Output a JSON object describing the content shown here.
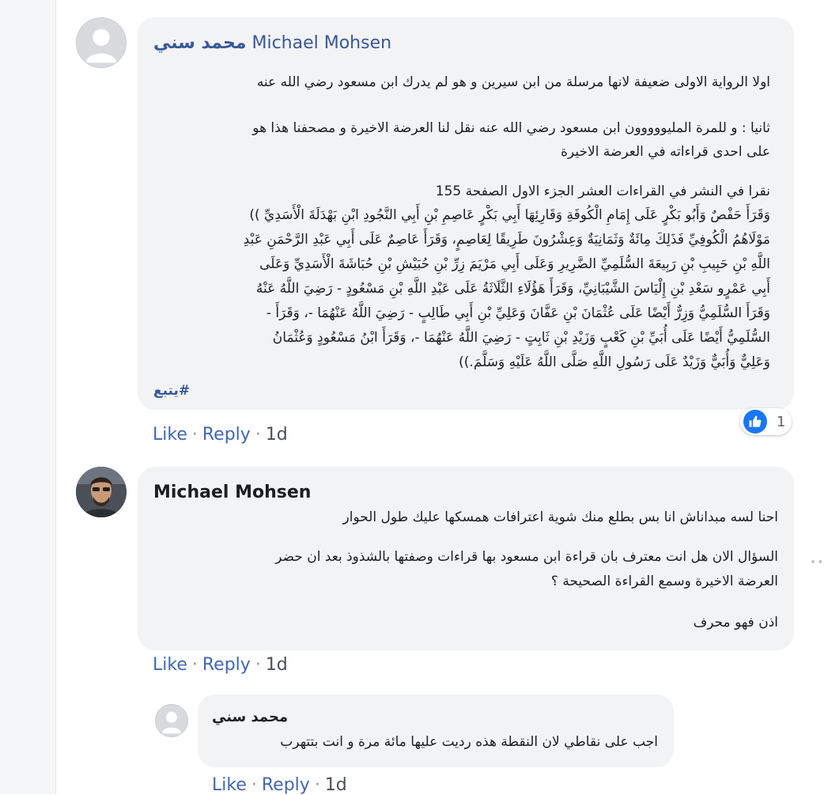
{
  "comments": [
    {
      "author_ar": "محمد سني",
      "author_en": "Michael Mohsen",
      "paragraphs": [
        "اولا الرواية الاولى ضعيفة لانها مرسلة من ابن سيرين و هو لم يدرك ابن مسعود رضي الله عنه",
        "ثانيا : و للمرة المليووووون ابن مسعود رضي الله عنه نقل لنا العرضة الاخيرة و مصحفنا هذا هو",
        "على احدى قراءاته في العرضة الاخيرة",
        "نقرا في النشر في القراءات العشر الجزء الاول الصفحة 155",
        "وَقَرَأَ حَفْصٌ وَأَبُو بَكْرٍ عَلَى إِمَامِ الْكُوفَةِ وَقَارِئِهَا أَبِي بَكْرٍ عَاصِمِ بْنِ أَبِي النَّجُودِ ابْنِ بَهْدَلَةَ الْأَسَدِيِّ ))",
        "مَوْلَاهُمُ الْكُوفِيِّ فَذَلِكَ مِائَةٌ وَثَمَانِيَةٌ وَعِشْرُونَ طَرِيقًا لِعَاصِمٍ، وَقَرَأَ عَاصِمٌ عَلَى أَبِي عَبْدِ الرَّحْمَنِ عَبْدِ",
        "اللَّهِ بْنِ حَبِيبِ بْنِ رَبِيعَةَ السُّلَمِيِّ الضَّرِيرِ وَعَلَى أَبِي مَرْيَمَ زِرِّ بْنِ حُبَيْشِ بْنِ حُبَاشَةَ الْأَسَدِيِّ وَعَلَى",
        "أَبِي عَمْرٍو سَعْدِ بْنِ إِلْيَاسَ الشَّيْبَانِيِّ، وَقَرَأَ هَؤُلَاءِ الثَّلَاثَةُ عَلَى عَبْدِ اللَّهِ بْنِ مَسْعُودٍ - رَضِيَ اللَّهُ عَنْهُ",
        "وَقَرَأَ السُّلَمِيُّ وَزِرٌّ أَيْضًا عَلَى عُثْمَانَ بْنِ عَفَّانَ وَعَلِيِّ بْنِ أَبِي طَالِبٍ - رَضِيَ اللَّهُ عَنْهُمَا -، وَقَرَأَ -",
        "السُّلَمِيُّ أَيْضًا عَلَى أُبَيِّ بْنِ كَعْبٍ وَزَيْدِ بْنِ ثَابِتٍ - رَضِيَ اللَّهُ عَنْهُمَا -، وَقَرَأَ ابْنُ مَسْعُودٍ وَعُثْمَانُ",
        "وَعَلِيٌّ وَأُبَيٌّ وَزَيْدٌ عَلَى رَسُولِ اللَّهِ صَلَّى اللَّهُ عَلَيْهِ وَسَلَّمَ.))",
        "#يتبع"
      ],
      "actions": {
        "like": "Like",
        "reply": "Reply",
        "time": "1d"
      },
      "reaction_count": "1"
    },
    {
      "author": "Michael Mohsen",
      "paragraphs": [
        "احنا لسه مبداناش انا بس بطلع منك شوية اعترافات همسكها عليك طول الحوار",
        "السؤال الان هل انت معترف بان قراءة ابن مسعود بها قراءات وصفتها بالشذوذ بعد ان حضر",
        "العرضة الاخيرة وسمع القراءة الصحيحة ؟",
        "اذن فهو محرف"
      ],
      "actions": {
        "like": "Like",
        "reply": "Reply",
        "time": "1d"
      }
    },
    {
      "author": "محمد سني",
      "paragraphs": [
        "اجب على نقاطي لان النقطة هذه رديت عليها مائة مرة و انت بتتهرب"
      ],
      "actions": {
        "like": "Like",
        "reply": "Reply",
        "time": "1d"
      }
    }
  ],
  "colors": {
    "link": "#385898",
    "action": "#4267b2",
    "bubble": "#f2f3f5",
    "like_blue": "#1877f2"
  }
}
